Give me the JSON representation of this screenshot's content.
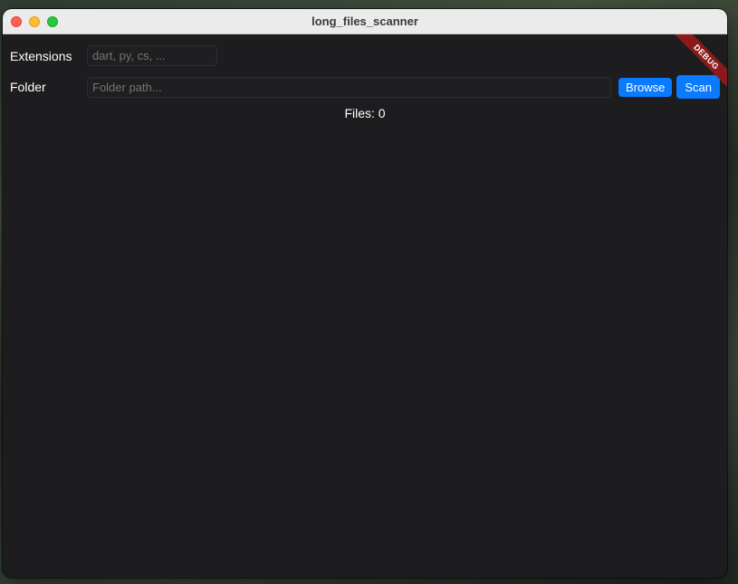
{
  "window": {
    "title": "long_files_scanner"
  },
  "form": {
    "extensions_label": "Extensions",
    "extensions_placeholder": "dart, py, cs, ...",
    "folder_label": "Folder",
    "folder_placeholder": "Folder path...",
    "browse_label": "Browse",
    "scan_label": "Scan"
  },
  "status": {
    "files_text": "Files: 0"
  },
  "debug_banner": "DEBUG",
  "colors": {
    "accent": "#0a7aff",
    "background": "#1d1d1f",
    "debug": "#8b1a1a"
  }
}
